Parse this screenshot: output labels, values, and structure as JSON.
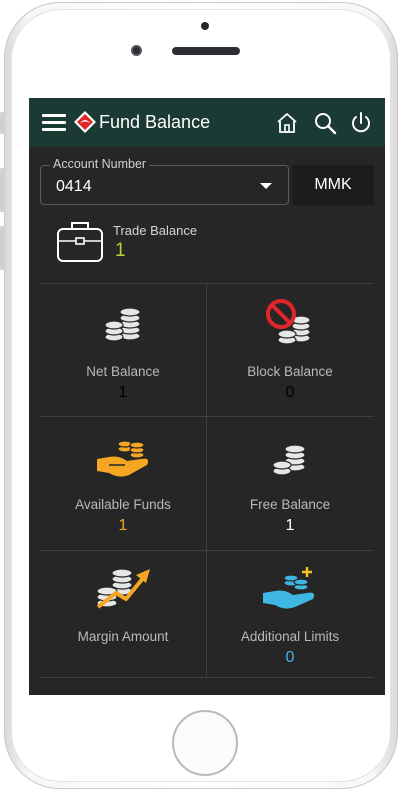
{
  "header": {
    "title": "Fund Balance"
  },
  "icons": {
    "menu": "hamburger-menu-icon",
    "logo": "diamond-logo-icon",
    "home": "home-icon",
    "search": "search-icon",
    "power": "power-icon"
  },
  "account": {
    "label": "Account Number",
    "value": "0414",
    "currency": "MMK"
  },
  "trade": {
    "label": "Trade Balance",
    "value": "1"
  },
  "tiles": [
    {
      "label": "Net Balance",
      "value": "1",
      "icon": "coins-stack-icon",
      "value_color": "#ffffff"
    },
    {
      "label": "Block Balance",
      "value": "0",
      "icon": "blocked-coins-icon",
      "value_color": "#ffffff"
    },
    {
      "label": "Available Funds",
      "value": "1",
      "icon": "hand-coins-icon",
      "value_color": "#f5a623"
    },
    {
      "label": "Free Balance",
      "value": "1",
      "icon": "coins-icon",
      "value_color": "#ffffff"
    },
    {
      "label": "Margin Amount",
      "value": "",
      "icon": "coins-growth-arrow-icon",
      "value_color": "#ffffff"
    },
    {
      "label": "Additional Limits",
      "value": "0",
      "icon": "hand-coins-plus-icon",
      "value_color": "#3fb7e3"
    }
  ],
  "colors": {
    "appbar": "#1a3a33",
    "screen_bg": "#262626",
    "trade_value": "#b5d432",
    "available_funds": "#f5a623",
    "additional_limits": "#3fb7e3",
    "block_icon": "#e0262b"
  }
}
